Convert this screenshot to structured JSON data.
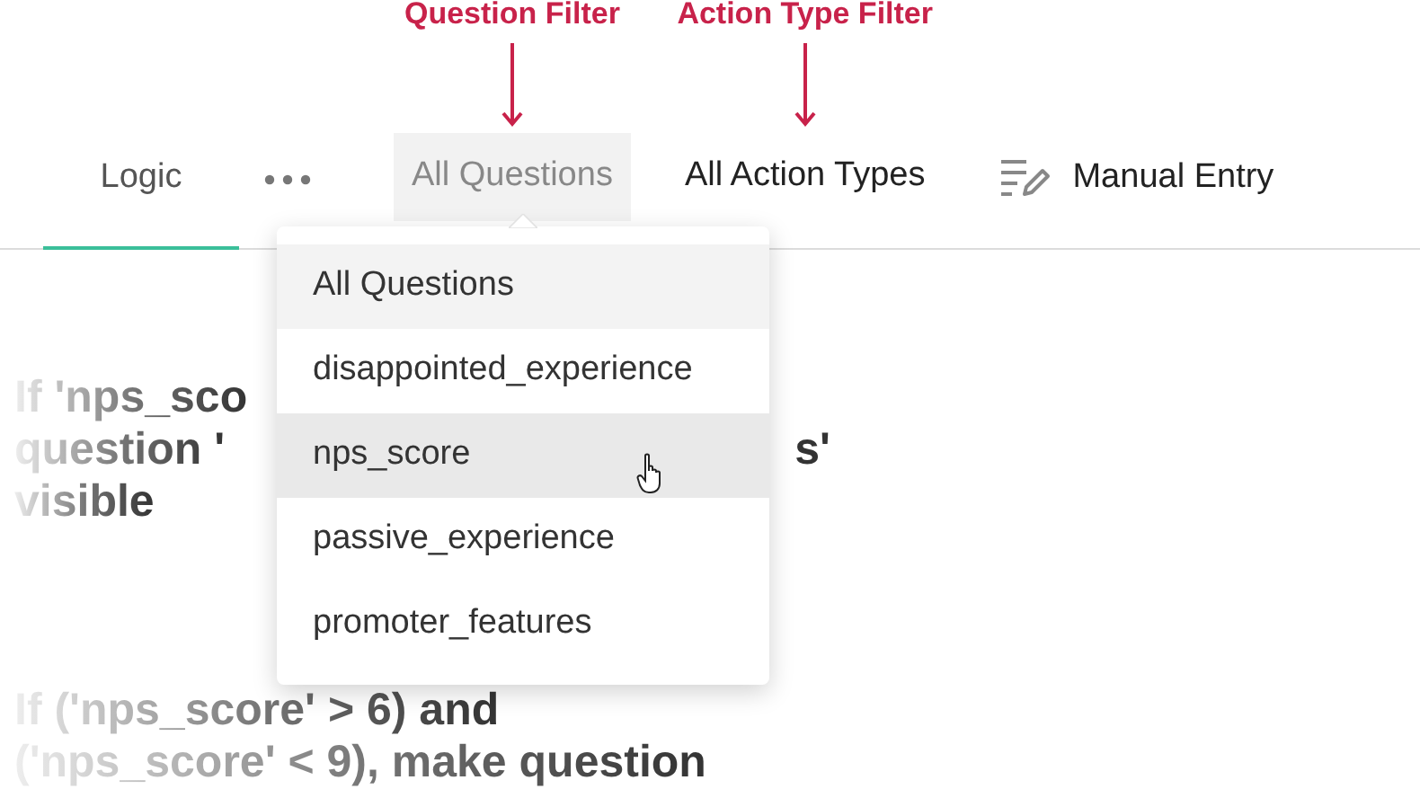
{
  "tabs": [
    {
      "label": "Logic",
      "selected": true
    }
  ],
  "filters": [
    {
      "label": "All Questions",
      "annotation": "Question Filter",
      "open": true
    },
    {
      "label": "All Action Types",
      "annotation": "Action Type Filter",
      "open": false
    }
  ],
  "manual_entry": {
    "label": "Manual Entry"
  },
  "dropdown": {
    "items": [
      {
        "label": "All Questions",
        "selected": true,
        "hovered": false
      },
      {
        "label": "disappointed_experience",
        "selected": false,
        "hovered": false
      },
      {
        "label": "nps_score",
        "selected": false,
        "hovered": true
      },
      {
        "label": "passive_experience",
        "selected": false,
        "hovered": false
      },
      {
        "label": "promoter_features",
        "selected": false,
        "hovered": false
      }
    ]
  },
  "rules": [
    {
      "lines": [
        [
          "If 'nps_sco"
        ],
        [
          "question '",
          "s'"
        ],
        [
          "visible"
        ]
      ]
    },
    {
      "lines": [
        [
          "If ('nps_score' > 6) and"
        ],
        [
          "('nps_score' < 9), make question"
        ]
      ]
    }
  ]
}
